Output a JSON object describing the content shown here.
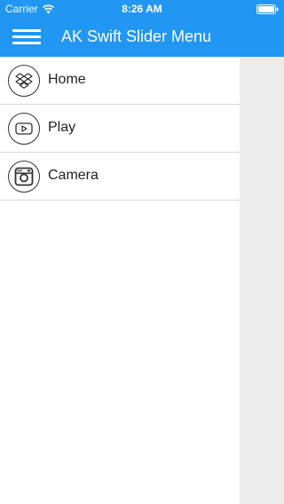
{
  "status_bar": {
    "carrier": "Carrier",
    "time": "8:26 AM"
  },
  "nav_bar": {
    "title": "AK Swift Slider Menu"
  },
  "menu": {
    "items": [
      {
        "label": "Home",
        "icon": "dropbox-icon"
      },
      {
        "label": "Play",
        "icon": "youtube-play-icon"
      },
      {
        "label": "Camera",
        "icon": "instagram-camera-icon"
      }
    ]
  },
  "colors": {
    "accent": "#2196f3",
    "panel": "#ffffff",
    "background": "#ececec",
    "divider": "#d9d9d9"
  }
}
